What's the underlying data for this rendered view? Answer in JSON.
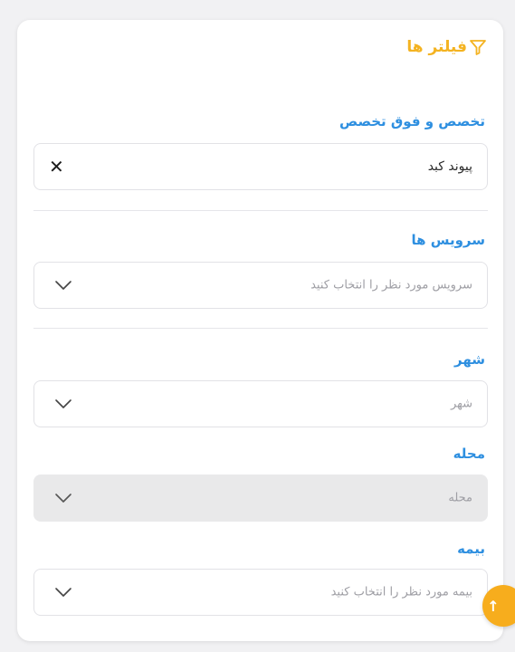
{
  "panel": {
    "title": "فیلتر ها",
    "icon": "filter-icon",
    "accent_color": "#f4b321",
    "label_color": "#2e8fe0"
  },
  "filters": {
    "specialty": {
      "label": "تخصص و فوق تخصص",
      "value": "پیوند کبد",
      "clear_icon": "close-icon"
    },
    "services": {
      "label": "سرویس ها",
      "placeholder": "سرویس مورد نظر را انتخاب کنید",
      "icon": "chevron-down-icon"
    },
    "city": {
      "label": "شهر",
      "placeholder": "شهر",
      "icon": "chevron-down-icon"
    },
    "neighborhood": {
      "label": "محله",
      "placeholder": "محله",
      "disabled": true,
      "icon": "chevron-down-icon"
    },
    "insurance": {
      "label": "بیمه",
      "placeholder": "بیمه مورد نظر را انتخاب کنید",
      "icon": "chevron-down-icon"
    }
  },
  "scroll_top": {
    "icon": "arrow-up-icon",
    "glyph": "↑",
    "color": "#f7ad1d"
  }
}
